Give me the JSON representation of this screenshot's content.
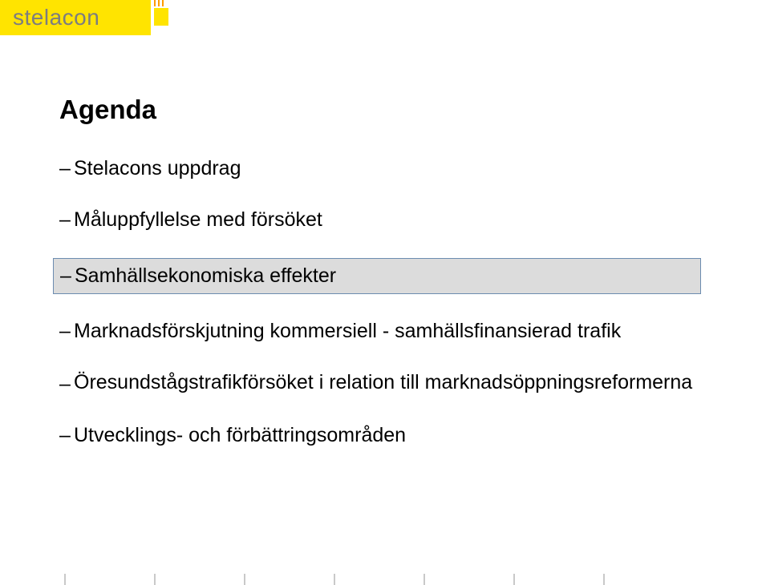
{
  "brand": {
    "name": "stelacon"
  },
  "title": "Agenda",
  "bullets": {
    "b1": "Stelacons uppdrag",
    "b2": "Måluppfyllelse med försöket",
    "b3": "Samhällsekonomiska effekter",
    "b4": "Marknadsförskjutning kommersiell - samhällsfinansierad trafik",
    "b5": "Öresundstågstrafikförsöket i relation till marknadsöppningsreformerna",
    "b6": "Utvecklings- och förbättringsområden"
  }
}
